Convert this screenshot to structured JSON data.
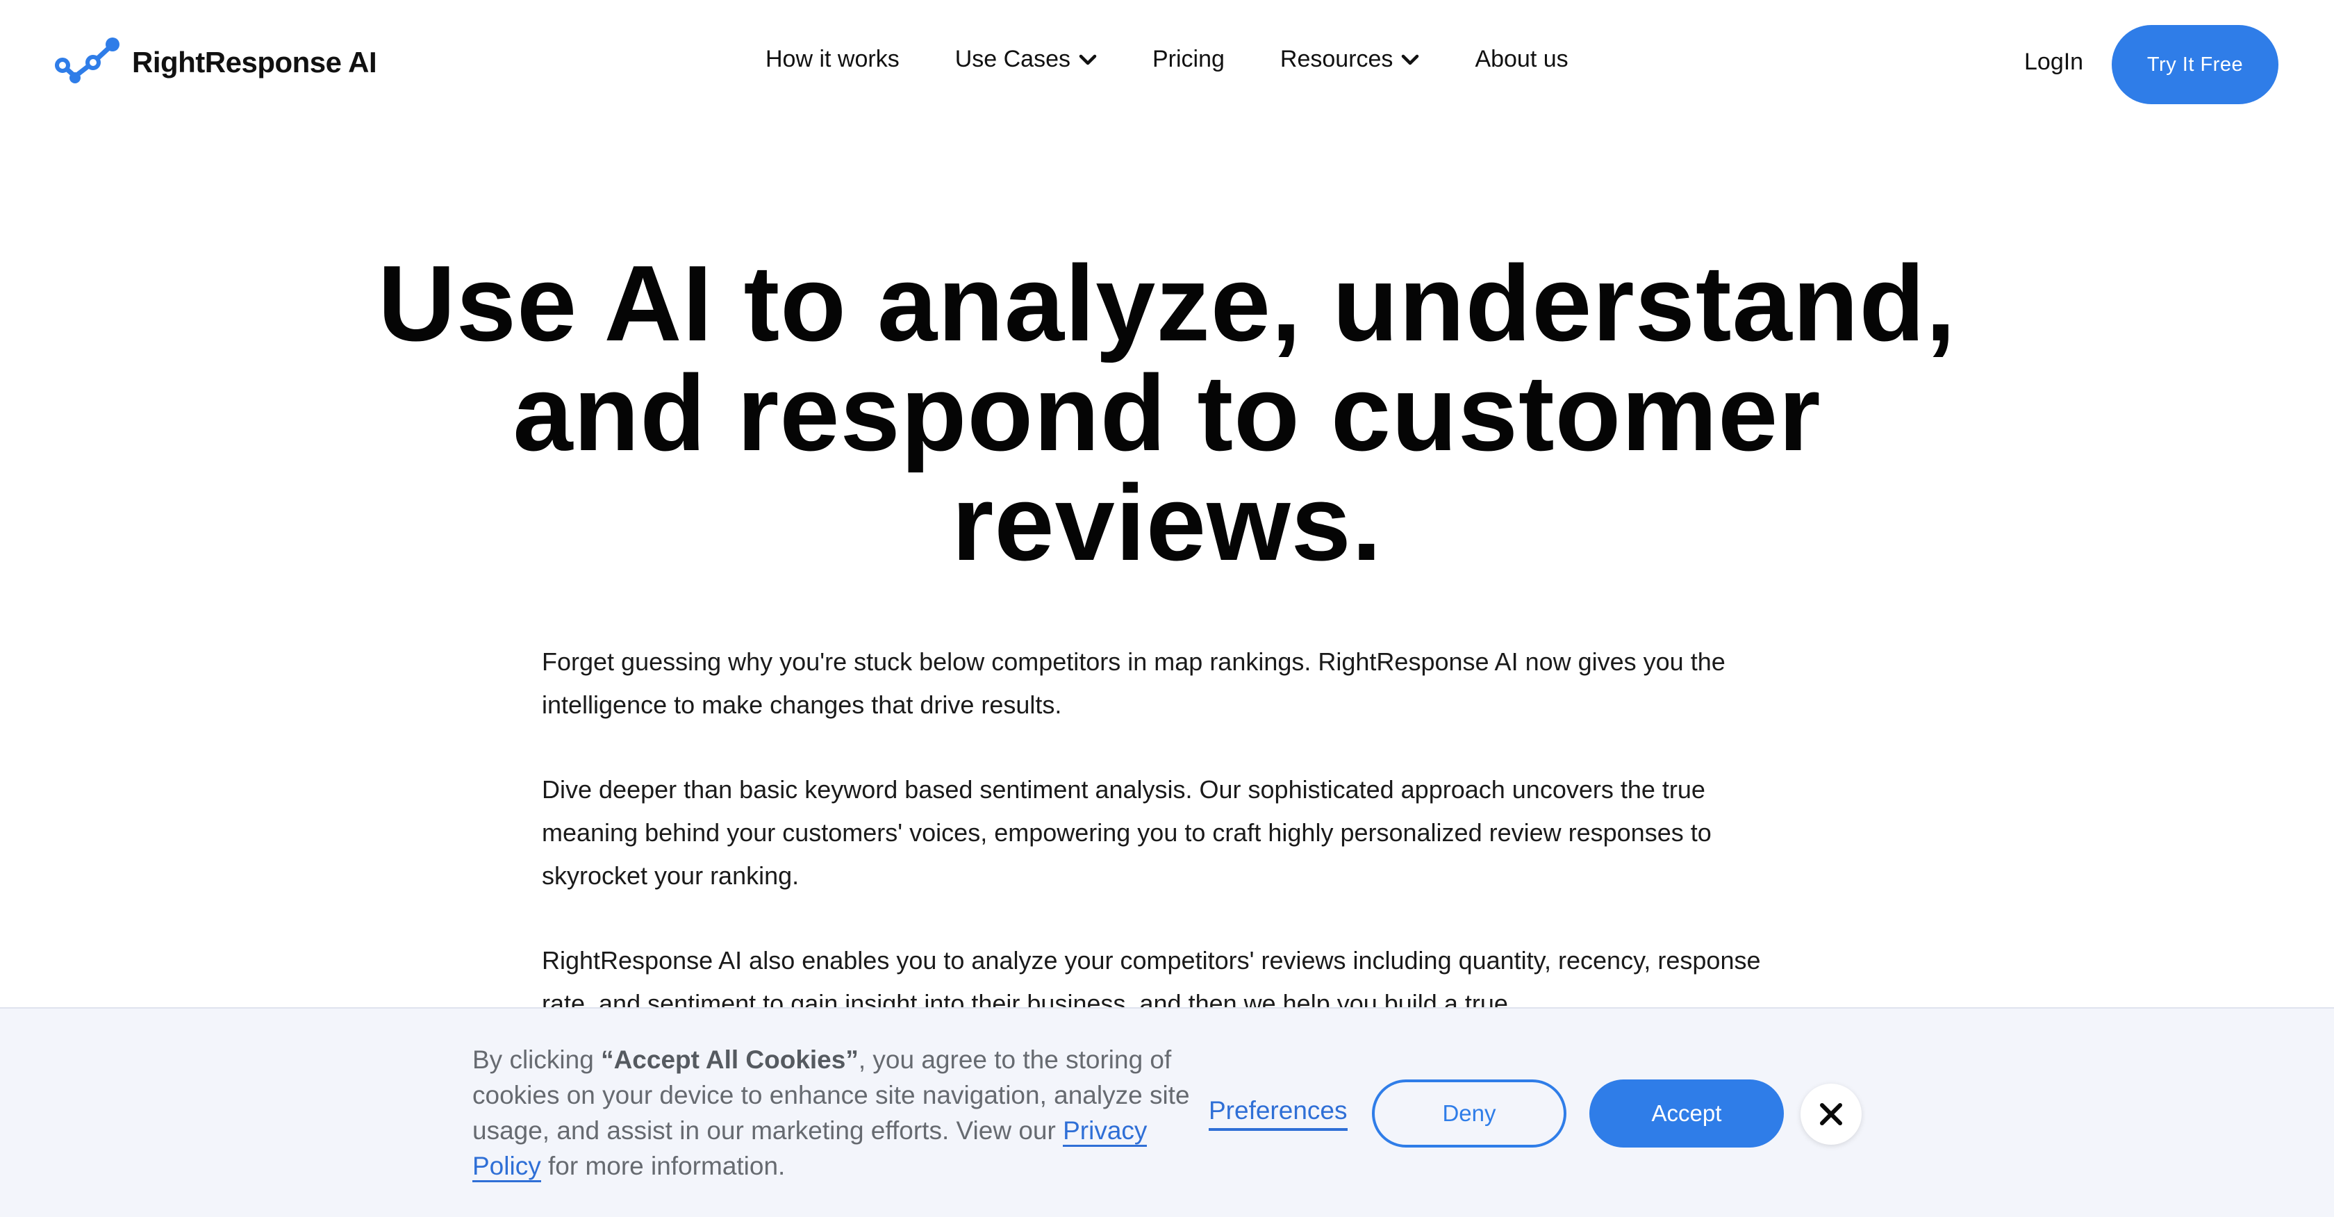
{
  "brand": {
    "name": "RightResponse AI",
    "accent_color": "#2f7de8",
    "logo_icon": "connected-nodes-icon"
  },
  "nav": {
    "items": [
      {
        "label": "How it works",
        "has_dropdown": false
      },
      {
        "label": "Use Cases",
        "has_dropdown": true
      },
      {
        "label": "Pricing",
        "has_dropdown": false
      },
      {
        "label": "Resources",
        "has_dropdown": true
      },
      {
        "label": "About us",
        "has_dropdown": false
      }
    ],
    "login_label": "LogIn",
    "cta_label": "Try It Free"
  },
  "hero": {
    "title_lines": [
      "Use AI to analyze, understand,",
      "and respond to customer",
      "reviews."
    ],
    "paragraphs": [
      "Forget guessing why you're stuck below competitors in map rankings. RightResponse AI now gives you the intelligence to make changes that drive results.",
      "Dive deeper than basic keyword based sentiment analysis. Our sophisticated approach uncovers the true meaning behind your customers' voices, empowering you to craft highly personalized review responses to skyrocket your ranking.",
      "RightResponse AI also enables you to analyze your competitors' reviews including quantity, recency, response rate, and sentiment to gain insight into their business, and then we help you build a true"
    ]
  },
  "cookie_banner": {
    "text_before": "By clicking ",
    "text_bold": "“Accept All Cookies”",
    "text_after": ", you agree to the storing of cookies on your device to enhance site navigation, analyze site usage, and assist in our marketing efforts. View our ",
    "privacy_link_label": "Privacy Policy",
    "text_end": " for more information.",
    "preferences_label": "Preferences",
    "deny_label": "Deny",
    "accept_label": "Accept",
    "close_icon": "close-icon"
  }
}
